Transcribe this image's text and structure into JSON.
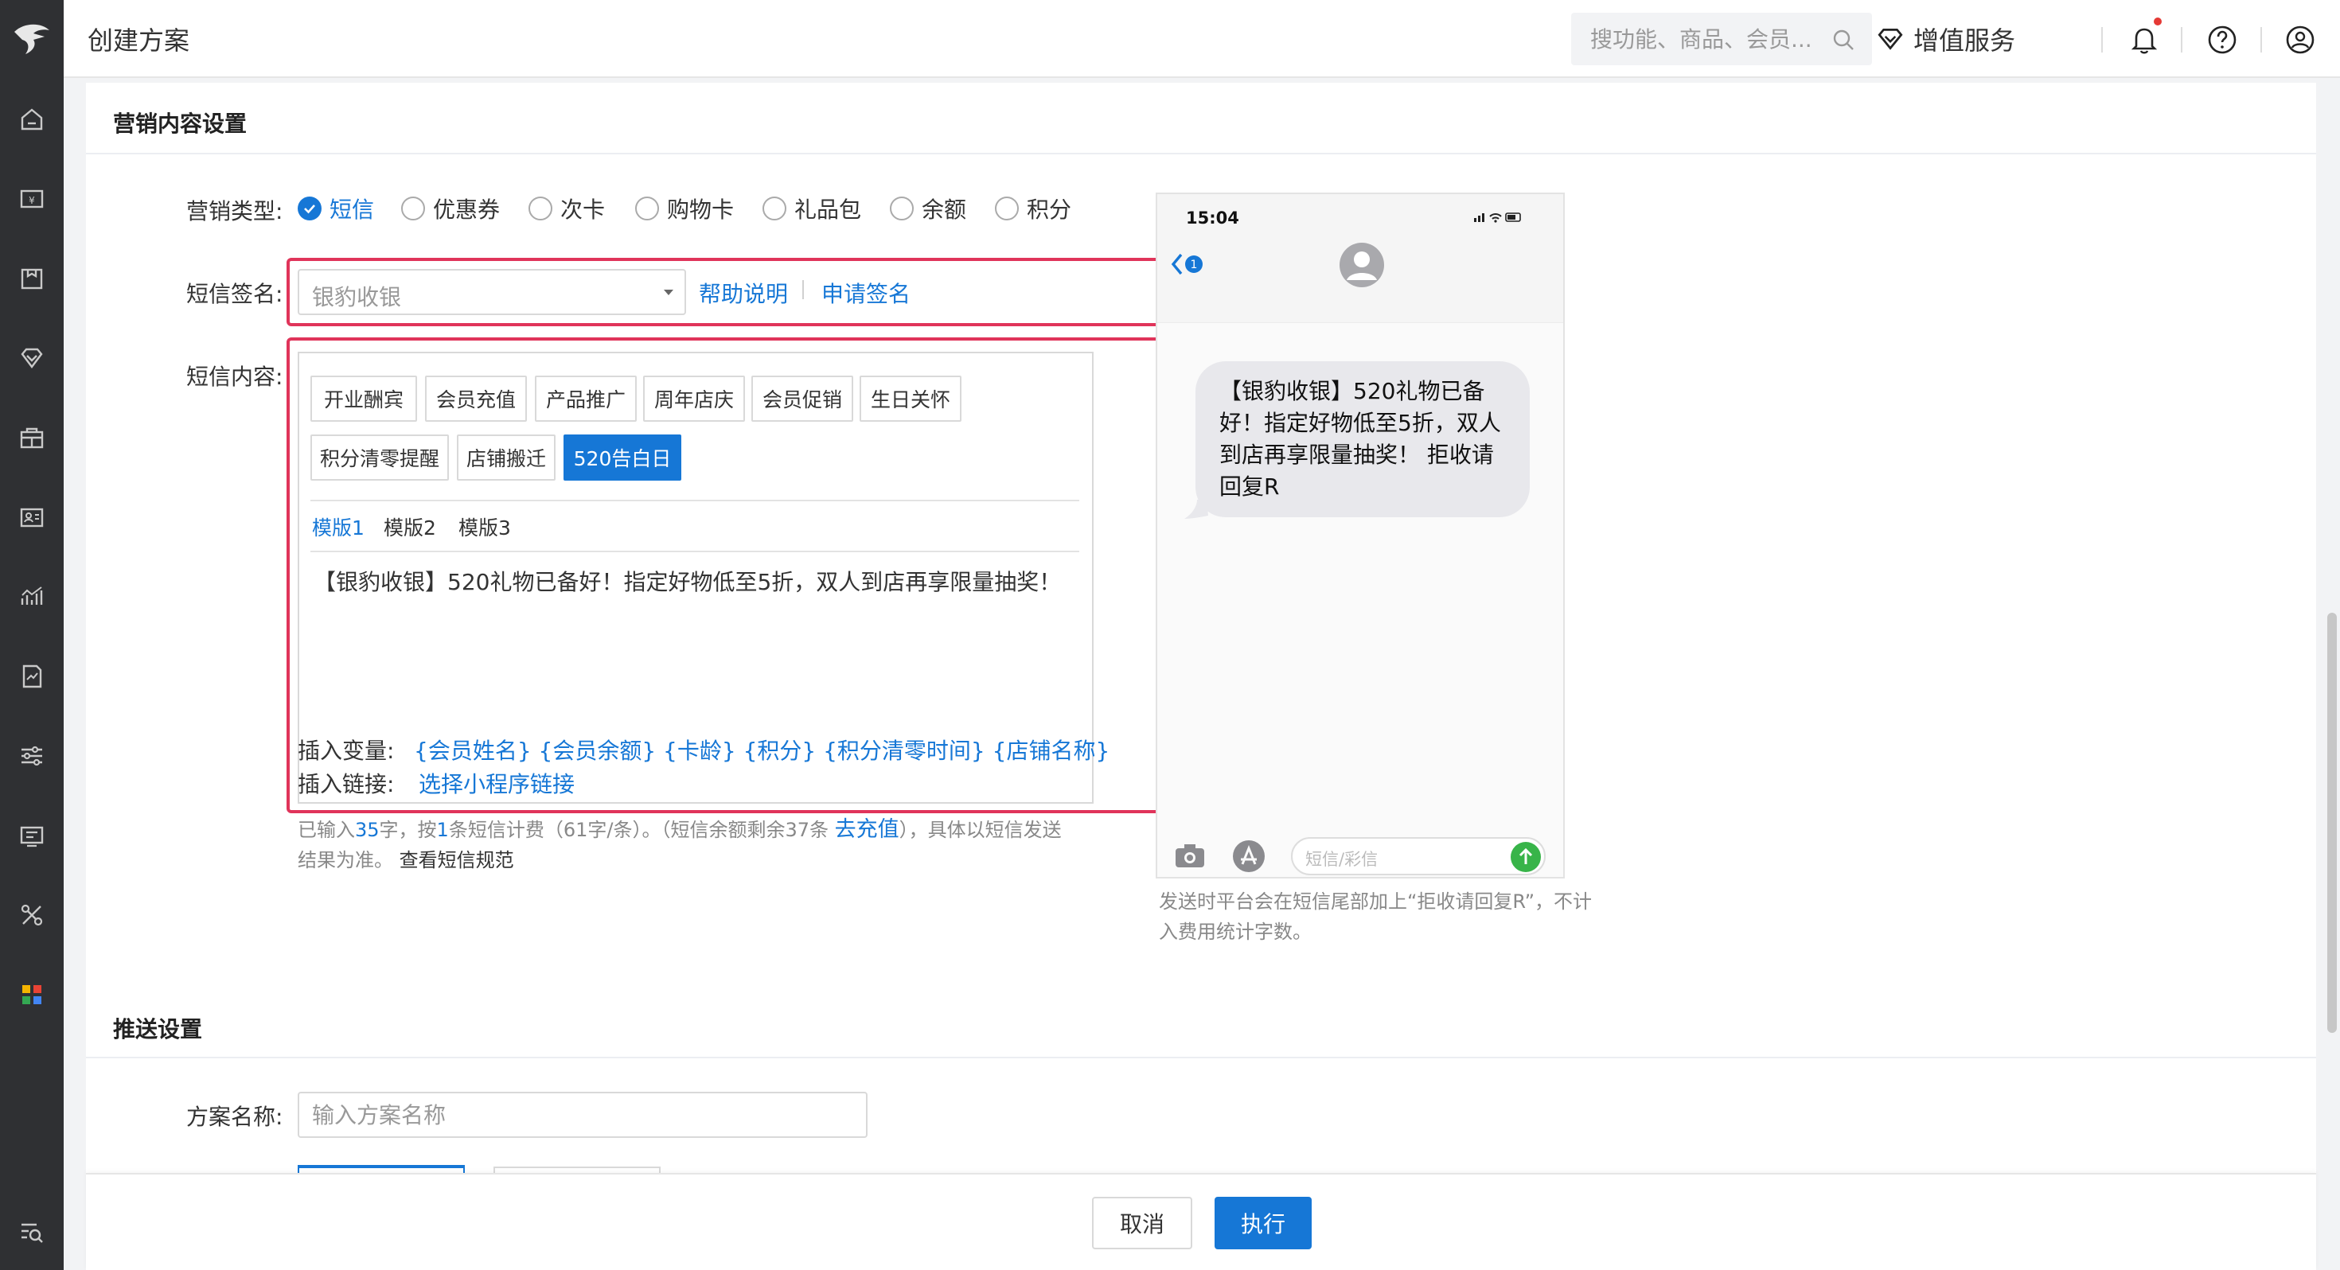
{
  "header": {
    "title": "创建方案",
    "search_placeholder": "搜功能、商品、会员...",
    "vip_label": "增值服务"
  },
  "sidebar": {
    "items": [
      "logo-icon",
      "home-icon",
      "cashier-icon",
      "goods-icon",
      "membership-icon",
      "marketing-icon",
      "member-card-icon",
      "statistics-icon",
      "report-icon",
      "settings-icon",
      "device-icon",
      "tools-icon",
      "apps-icon",
      "search-menu-icon"
    ]
  },
  "marketing": {
    "section_title": "营销内容设置",
    "type_label": "营销类型:",
    "types": [
      "短信",
      "优惠券",
      "次卡",
      "购物卡",
      "礼品包",
      "余额",
      "积分"
    ],
    "selected_type": "短信",
    "sign_label": "短信签名:",
    "sign_value": "银豹收银",
    "help_link": "帮助说明",
    "apply_link": "申请签名",
    "content_label": "短信内容:",
    "templates_row1": [
      "开业酬宾",
      "会员充值",
      "产品推广",
      "周年店庆",
      "会员促销",
      "生日关怀"
    ],
    "templates_row2": [
      "积分清零提醒",
      "店铺搬迁",
      "520告白日"
    ],
    "active_template": "520告白日",
    "versions": [
      "模版1",
      "模版2",
      "模版3"
    ],
    "active_version": "模版1",
    "sms_text": "【银豹收银】520礼物已备好！指定好物低至5折，双人到店再享限量抽奖！",
    "insert_var_label": "插入变量:",
    "insert_vars": "{会员姓名} {会员余额} {卡龄} {积分} {积分清零时间} {店铺名称}",
    "insert_link_label": "插入链接:",
    "insert_link": "选择小程序链接",
    "count_hint_1": "已输入",
    "count_chars": "35",
    "count_hint_2": "字，按",
    "count_msgs": "1",
    "count_hint_3": "条短信计费（61字/条）。（短信余额剩余37条",
    "recharge_link": "去充值",
    "count_hint_4": "），具体以短信发送",
    "count_hint_5": "结果为准。",
    "rules_link": "查看短信规范"
  },
  "preview": {
    "time": "15:04",
    "back_badge": "1",
    "bubble_text": "【银豹收银】520礼物已备好！指定好物低至5折，双人到店再享限量抽奖！ 拒收请回复R",
    "input_placeholder": "短信/彩信",
    "note": "发送时平台会在短信尾部加上“拒收请回复R”，不计入费用统计字数。"
  },
  "push": {
    "section_title": "推送设置",
    "plan_name_label": "方案名称:",
    "plan_name_placeholder": "输入方案名称"
  },
  "footer": {
    "cancel": "取消",
    "execute": "执行"
  },
  "colors": {
    "primary": "#1677d6",
    "highlight_border": "#e0345a",
    "sidebar_bg": "#2f3033",
    "send_green": "#38b449"
  }
}
